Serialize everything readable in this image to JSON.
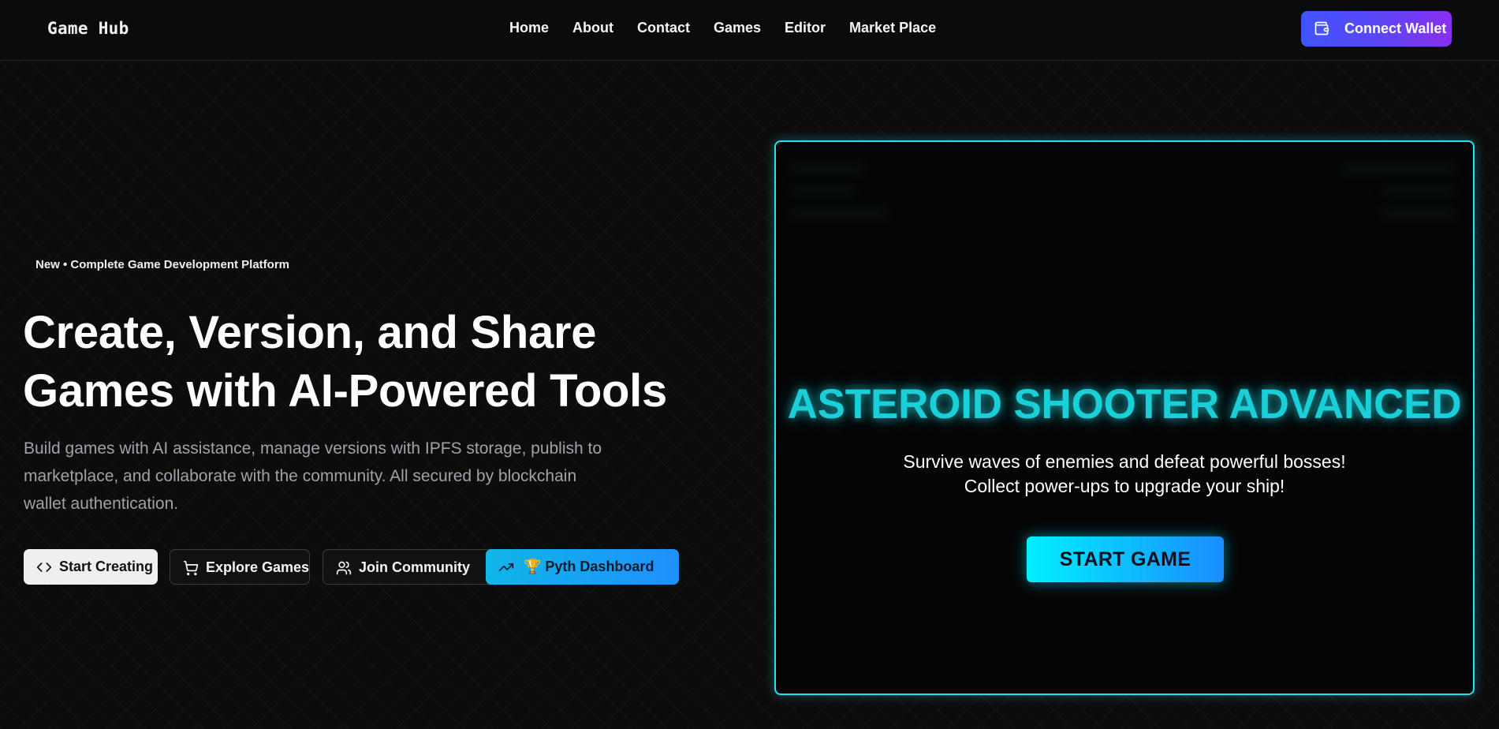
{
  "header": {
    "logo": "Game Hub",
    "nav": [
      "Home",
      "About",
      "Contact",
      "Games",
      "Editor",
      "Market Place"
    ],
    "wallet_button": "Connect Wallet"
  },
  "hero": {
    "badge": "New • Complete Game Development Platform",
    "title_line1": "Create, Version, and Share",
    "title_line2": "Games with AI-Powered Tools",
    "description": "Build games with AI assistance, manage versions with IPFS storage, publish to marketplace, and collaborate with the community. All secured by blockchain wallet authentication.",
    "buttons": {
      "start_creating": "Start Creating",
      "explore_games": "Explore Games",
      "join_community": "Join Community",
      "pyth_dashboard": "🏆 Pyth Dashboard"
    }
  },
  "game": {
    "title": "ASTEROID SHOOTER ADVANCED",
    "subtitle_line1": "Survive waves of enemies and defeat powerful bosses!",
    "subtitle_line2": "Collect power-ups to upgrade your ship!",
    "start_button": "START GAME"
  },
  "colors": {
    "accent_cyan": "#22e3f5",
    "wallet_gradient_start": "#3f55ff",
    "wallet_gradient_end": "#8a2ff0",
    "pyth_gradient_start": "#0fb6e8"
  }
}
